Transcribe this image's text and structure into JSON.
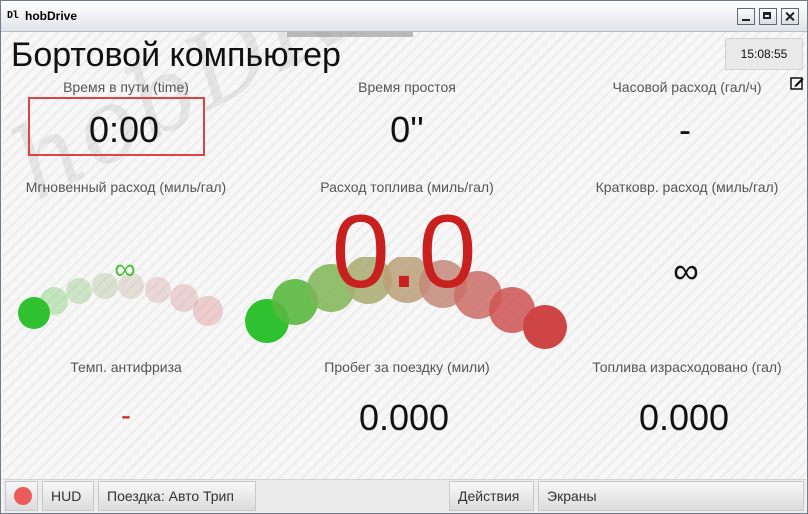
{
  "window": {
    "title": "hobDrive",
    "icon": "app-icon"
  },
  "header": {
    "title": "Бортовой компьютер",
    "clock": "15:08:55",
    "watermark": "hobDRIVE"
  },
  "cells": {
    "time": {
      "label": "Время в пути (time)",
      "value": "0:00"
    },
    "idle": {
      "label": "Время простоя",
      "value": "0''"
    },
    "hourly": {
      "label": "Часовой расход (гал/ч)",
      "value": "-"
    },
    "instant": {
      "label": "Мгновенный расход (миль/гал)",
      "value": "∞"
    },
    "fuel": {
      "label": "Расход топлива (миль/гал)",
      "value": "0.0"
    },
    "shortterm": {
      "label": "Кратковр. расход (миль/гал)",
      "value": "∞"
    },
    "coolant": {
      "label": "Темп. антифриза",
      "value": "-"
    },
    "trip_distance": {
      "label": "Пробег за поездку (мили)",
      "value": "0.000"
    },
    "fuel_used": {
      "label": "Топлива израсходовано (гал)",
      "value": "0.000"
    }
  },
  "bottom": {
    "hud": "HUD",
    "trip": "Поездка: Авто Трип",
    "actions": "Действия",
    "screens": "Экраны"
  },
  "colors": {
    "accent_red": "#c81f1f",
    "selection_border": "#d94545",
    "gauge_green": "#2fc12f"
  }
}
